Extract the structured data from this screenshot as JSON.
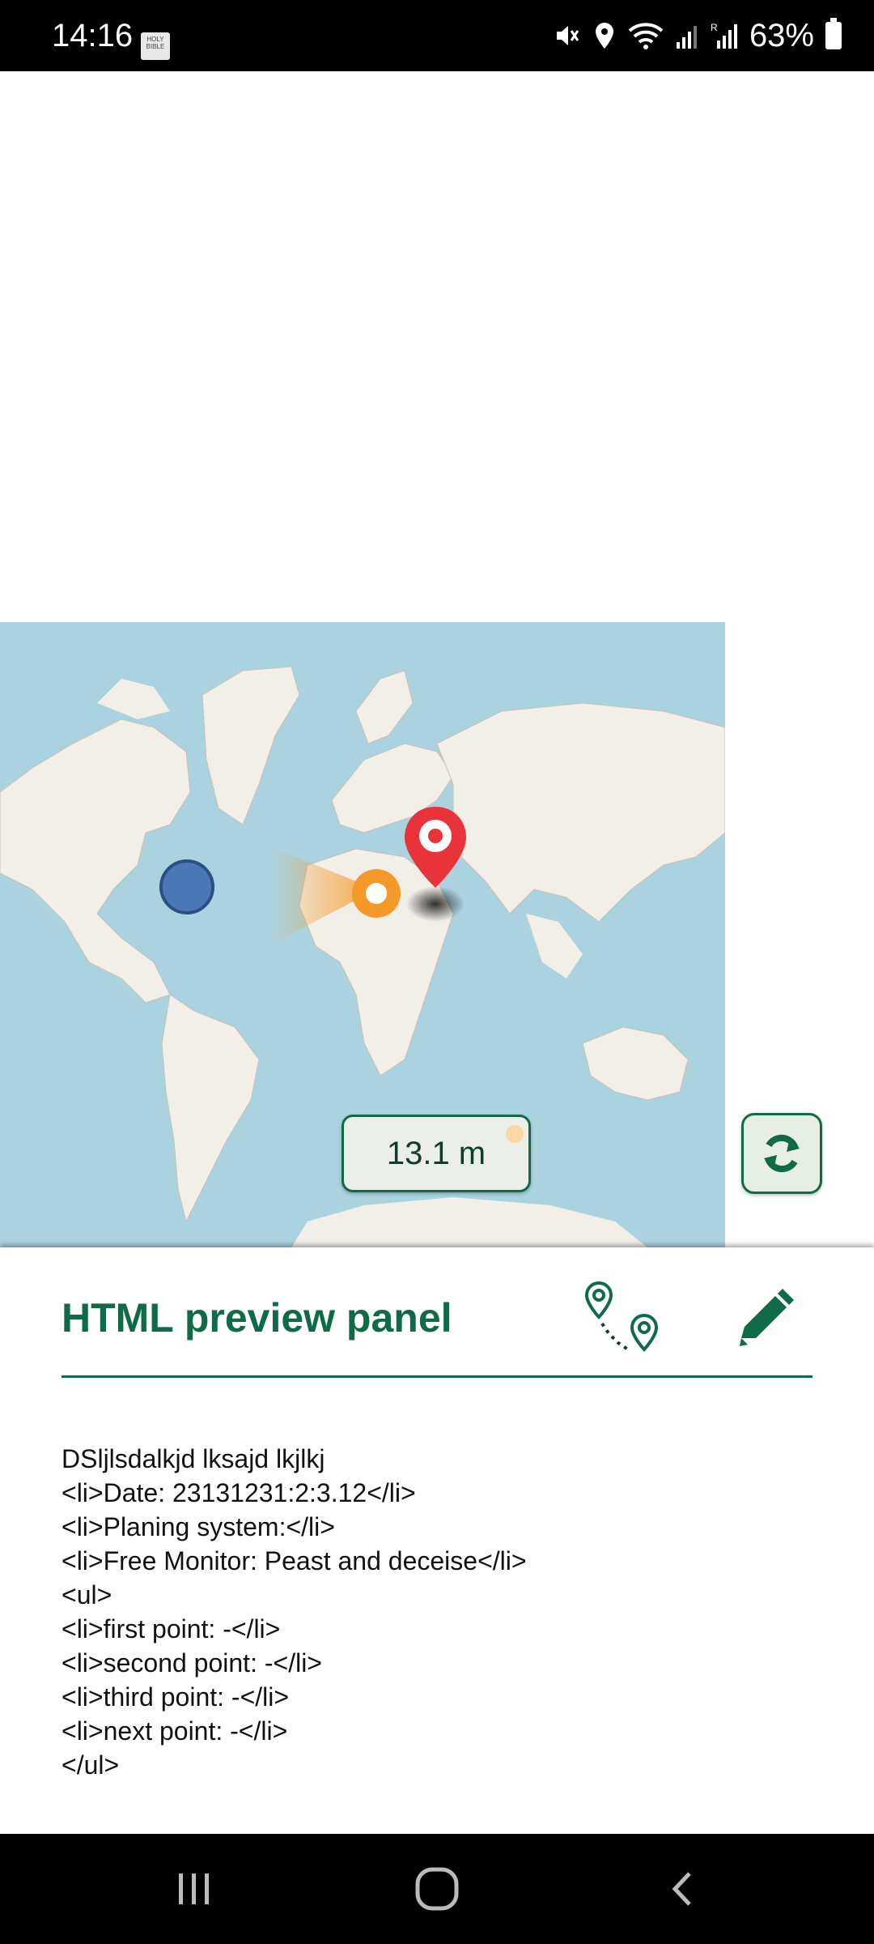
{
  "status_bar": {
    "time": "14:16",
    "battery_percent": "63%",
    "icons": [
      "bible-app-icon",
      "mute-icon",
      "location-icon",
      "wifi-icon",
      "signal-icon",
      "roaming-signal-icon",
      "battery-icon"
    ]
  },
  "map": {
    "distance_label": "13.1 m",
    "markers": [
      "user-location-dot",
      "orange-location-marker",
      "red-destination-pin"
    ],
    "colors": {
      "water": "#aad3df",
      "land": "#f2efe9",
      "accent": "#0f6b45",
      "pin": "#e8333a",
      "orange": "#f59a2a",
      "blue": "#4a78b6"
    }
  },
  "panel": {
    "title": "HTML preview panel",
    "route_button_icon": "route-points-icon",
    "edit_button_icon": "pencil-icon",
    "lines": [
      "DSljlsdalkjd lksajd lkjlkj",
      "<li>Date: 23131231:2:3.12</li>",
      "<li>Planing system:</li>",
      "<li>Free Monitor: Peast and deceise</li>",
      "<ul>",
      "<li>first point: -</li>",
      "<li>second point: -</li>",
      "<li>third point: -</li>",
      "<li>next point: -</li>",
      "</ul>"
    ]
  },
  "nav_bar": {
    "buttons": [
      "recent-apps-icon",
      "home-icon",
      "back-icon"
    ]
  }
}
